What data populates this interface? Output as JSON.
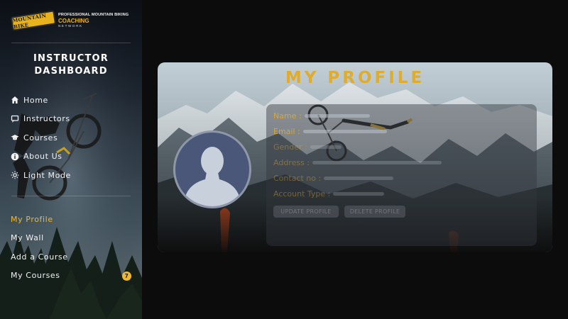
{
  "brand": {
    "badge": "MOUNTAIN BIKE",
    "line1": "PROFESSIONAL MOUNTAIN BIKING",
    "line2": "COACHING",
    "line3": "NETWORK"
  },
  "sidebar": {
    "title_line1": "INSTRUCTOR",
    "title_line2": "DASHBOARD",
    "nav": [
      {
        "label": "Home",
        "icon": "home-icon"
      },
      {
        "label": "Instructors",
        "icon": "chat-icon"
      },
      {
        "label": "Courses",
        "icon": "graduation-cap-icon"
      },
      {
        "label": "About Us",
        "icon": "info-icon"
      },
      {
        "label": "Light Mode",
        "icon": "sun-icon"
      }
    ],
    "subnav": [
      {
        "label": "My Profile",
        "active": true
      },
      {
        "label": "My Wall"
      },
      {
        "label": "Add a Course"
      },
      {
        "label": "My Courses",
        "badge": "7"
      }
    ]
  },
  "profile": {
    "title": "MY PROFILE",
    "fields": [
      {
        "label": "Name :"
      },
      {
        "label": "Email :"
      },
      {
        "label": "Gender :"
      },
      {
        "label": "Address :"
      },
      {
        "label": "Contact no :"
      },
      {
        "label": "Account Type :"
      }
    ],
    "buttons": [
      "UPDATE PROFILE",
      "DELETE PROFILE"
    ]
  },
  "colors": {
    "accent": "#e0ac2c",
    "avatar_bg": "#4a5779",
    "background": "#0c0c0c"
  }
}
